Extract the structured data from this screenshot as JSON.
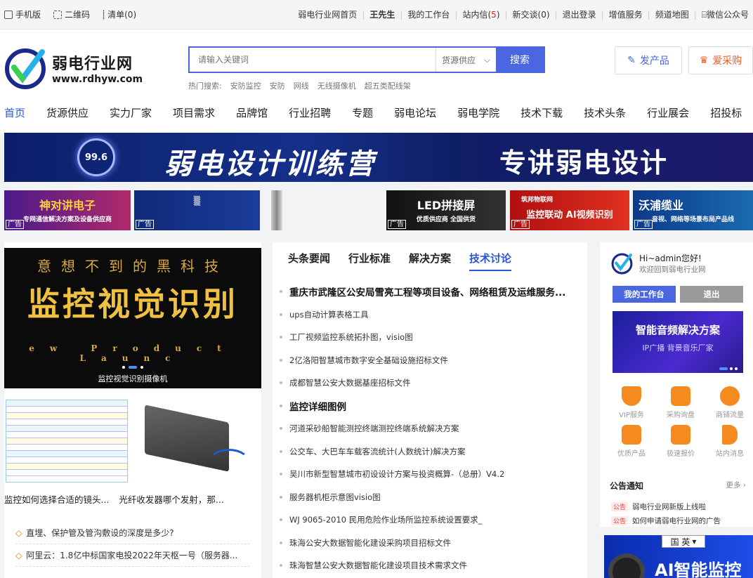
{
  "topbar": {
    "left": [
      "手机版",
      "二维码",
      "清单(0)"
    ],
    "home": "弱电行业网首页",
    "user": "王先生",
    "workspace": "我的工作台",
    "inbox_pre": "站内信(",
    "inbox_count": "5",
    "inbox_post": ")",
    "friends": "新交谈(0)",
    "logout": "退出登录",
    "vip": "增值服务",
    "sitemap": "频道地图",
    "wechat": "微信公众号"
  },
  "logo": {
    "name": "弱电行业网",
    "url": "www.rdhyw.com"
  },
  "search": {
    "placeholder": "请输入关键词",
    "category": "货源供应",
    "button": "搜索",
    "hot_label": "热门搜索:",
    "hot": [
      "安防监控",
      "安防",
      "网线",
      "无线摄像机",
      "超五类配线架"
    ]
  },
  "header_buttons": {
    "publish": "发产品",
    "purchase": "爱采购"
  },
  "nav": [
    "首页",
    "货源供应",
    "实力厂家",
    "项目需求",
    "品牌馆",
    "行业招聘",
    "专题",
    "弱电论坛",
    "弱电学院",
    "技术下载",
    "技术头条",
    "行业展会",
    "招投标"
  ],
  "banner": {
    "gauge": "99.6",
    "title": "弱电设计训练营",
    "subtitle": "专讲弱电设计"
  },
  "ads": [
    {
      "main": "神对讲电子",
      "sub": "专网通信解决方案及设备供应商",
      "tag": "广告"
    },
    {
      "main": "",
      "sub": "",
      "tag": "广告"
    },
    {
      "main": "LED拼接屏",
      "sub": "优质供应商 全国供货",
      "tag": "广告"
    },
    {
      "main": "监控联动 AI视频识别",
      "sub": "筑邦物联网",
      "tag": "广告"
    },
    {
      "main": "沃浦缆业",
      "sub": "音视、网络等场景布局产品线",
      "tag": "广告"
    }
  ],
  "slide": {
    "line1": "意想不到的黑科技",
    "line2": "监控视觉识别",
    "line3": "ew Product Launc",
    "caption": "监控视觉识别摄像机"
  },
  "thumb_captions": [
    "监控如何选择合适的镜头...",
    "光纤收发器哪个发射，那..."
  ],
  "questions": [
    "直埋、保护管及管沟敷设的深度是多少?",
    "阿里云：1.8亿中标国家电投2022年天枢一号（服务器..."
  ],
  "tabs": [
    "头条要闻",
    "行业标准",
    "解决方案",
    "技术讨论"
  ],
  "news": [
    {
      "text": "重庆市武隆区公安局雪亮工程等项目设备、网络租赁及运维服务...",
      "headline": true
    },
    {
      "text": "ups自动计算表格工具",
      "headline": false
    },
    {
      "text": "工厂视频监控系统拓扑图，visio图",
      "headline": false
    },
    {
      "text": "2亿洛阳智慧城市数字安全基础设施招标文件",
      "headline": false
    },
    {
      "text": "成都智慧公安大数据基座招标文件",
      "headline": false
    },
    {
      "text": "监控详细图例",
      "headline": true
    },
    {
      "text": "河道采砂船智能测控终端测控终端系统解决方案",
      "headline": false
    },
    {
      "text": "公交车、大巴车车载客流统计(人数统计)解决方案",
      "headline": false
    },
    {
      "text": "吴川市新型智慧城市初设设计方案与投资概算-（总册）V4.2",
      "headline": false
    },
    {
      "text": "服务器机柜示意图visio图",
      "headline": false
    },
    {
      "text": "WJ 9065-2010 民用危险作业场所监控系统设置要求_",
      "headline": false
    },
    {
      "text": "珠海公安大数据智能化建设采购项目招标文件",
      "headline": false
    },
    {
      "text": "珠海智慧公安大数据智能化建设项目技术需求文件",
      "headline": false
    }
  ],
  "sidebar": {
    "greeting": "Hi~admin您好!",
    "welcome": "欢迎回到弱电行业网",
    "workspace_btn": "我的工作台",
    "logout_btn": "退出",
    "promo_title": "智能音频解决方案",
    "promo_sub": "IP广播  背景音乐厂家",
    "services": [
      "VIP服务",
      "采购询盘",
      "商铺流量",
      "优质产品",
      "极速报价",
      "站内消息"
    ],
    "notice_title": "公告通知",
    "notice_more": "更多",
    "notices": [
      {
        "tag": "公告",
        "text": "弱电行业网新版上线啦"
      },
      {
        "tag": "公告",
        "text": "如何申请弱电行业网的广告"
      }
    ]
  },
  "ai_ad": {
    "lang": "国 英",
    "text": "AI智能监控"
  },
  "colors": {
    "brand_blue": "#4a66e0",
    "nav_active": "#2b56d8",
    "accent_orange": "#f58a1f",
    "alert_red": "#e02020"
  }
}
